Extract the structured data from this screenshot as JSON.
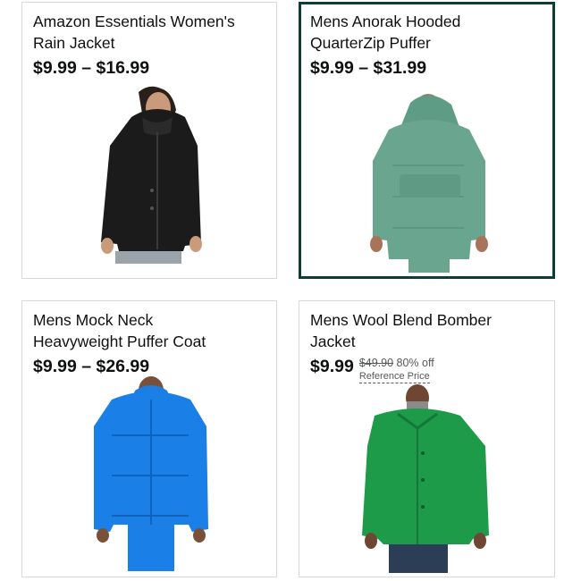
{
  "colors": {
    "selected_border": "#0e3d34",
    "card_border": "#d5d9d9",
    "text": "#0f1111",
    "muted": "#565959"
  },
  "products": [
    {
      "title_line1": "Amazon Essentials Women's",
      "title_line2": "Rain Jacket",
      "price": "$9.99 – $16.99",
      "image": "black-rain-jacket-photo"
    },
    {
      "title_line1": "Mens Anorak Hooded",
      "title_line2": "QuarterZip Puffer",
      "price": "$9.99 – $31.99",
      "image": "green-anorak-puffer-photo",
      "selected": true
    },
    {
      "title_line1": "Mens Mock Neck",
      "title_line2": "Heavyweight Puffer Coat",
      "price": "$9.99 – $26.99",
      "image": "blue-puffer-coat-photo"
    },
    {
      "title_line1": "Mens Wool Blend Bomber",
      "title_line2": "Jacket",
      "price": "$9.99",
      "list_price": "$49.90",
      "discount": "80% off",
      "reference_label": "Reference Price",
      "image": "green-bomber-jacket-photo"
    }
  ]
}
